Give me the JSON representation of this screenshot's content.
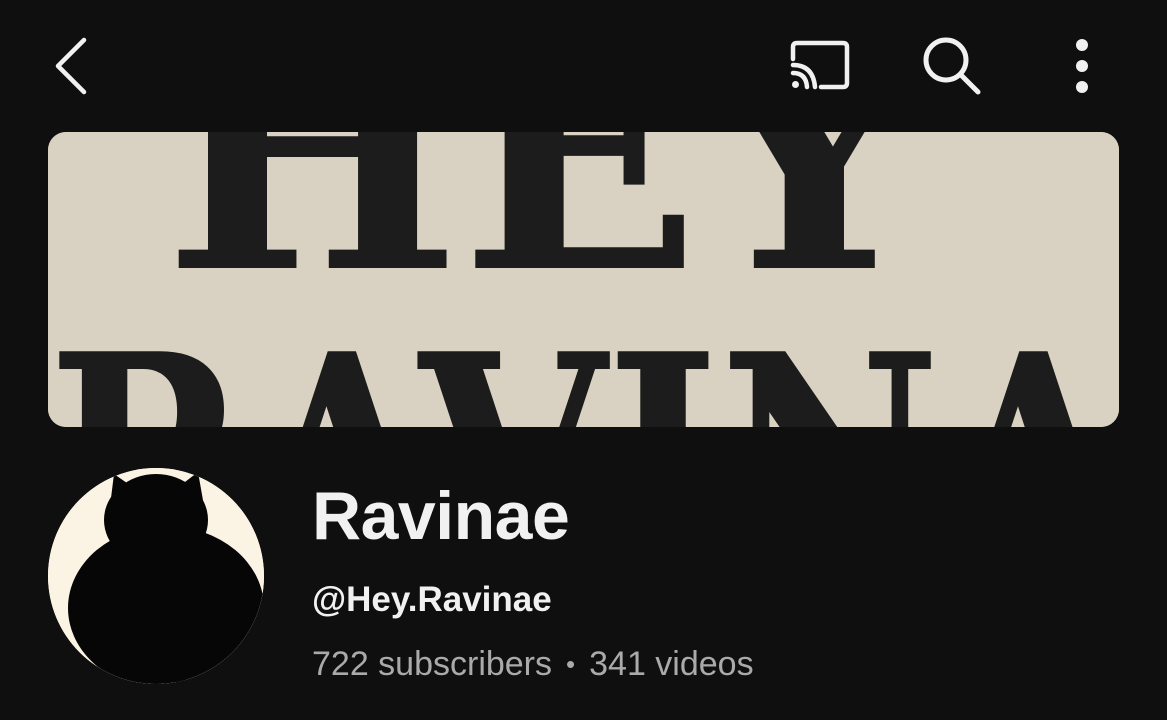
{
  "topbar": {
    "back_icon": "chevron-left-icon",
    "cast_icon": "cast-icon",
    "search_icon": "search-icon",
    "more_icon": "more-vertical-icon"
  },
  "banner": {
    "line1": "HEY",
    "line2": "RAVINA"
  },
  "channel": {
    "name": "Ravinae",
    "handle": "@Hey.Ravinae",
    "subscribers": "722 subscribers",
    "separator": "•",
    "videos": "341 videos"
  },
  "colors": {
    "background": "#0f0f0f",
    "text_primary": "#f1f1f1",
    "text_secondary": "#aaaaaa",
    "banner_bg": "#d9d1c1",
    "banner_text": "#1c1c1c",
    "avatar_bg": "#fbf3e4"
  }
}
